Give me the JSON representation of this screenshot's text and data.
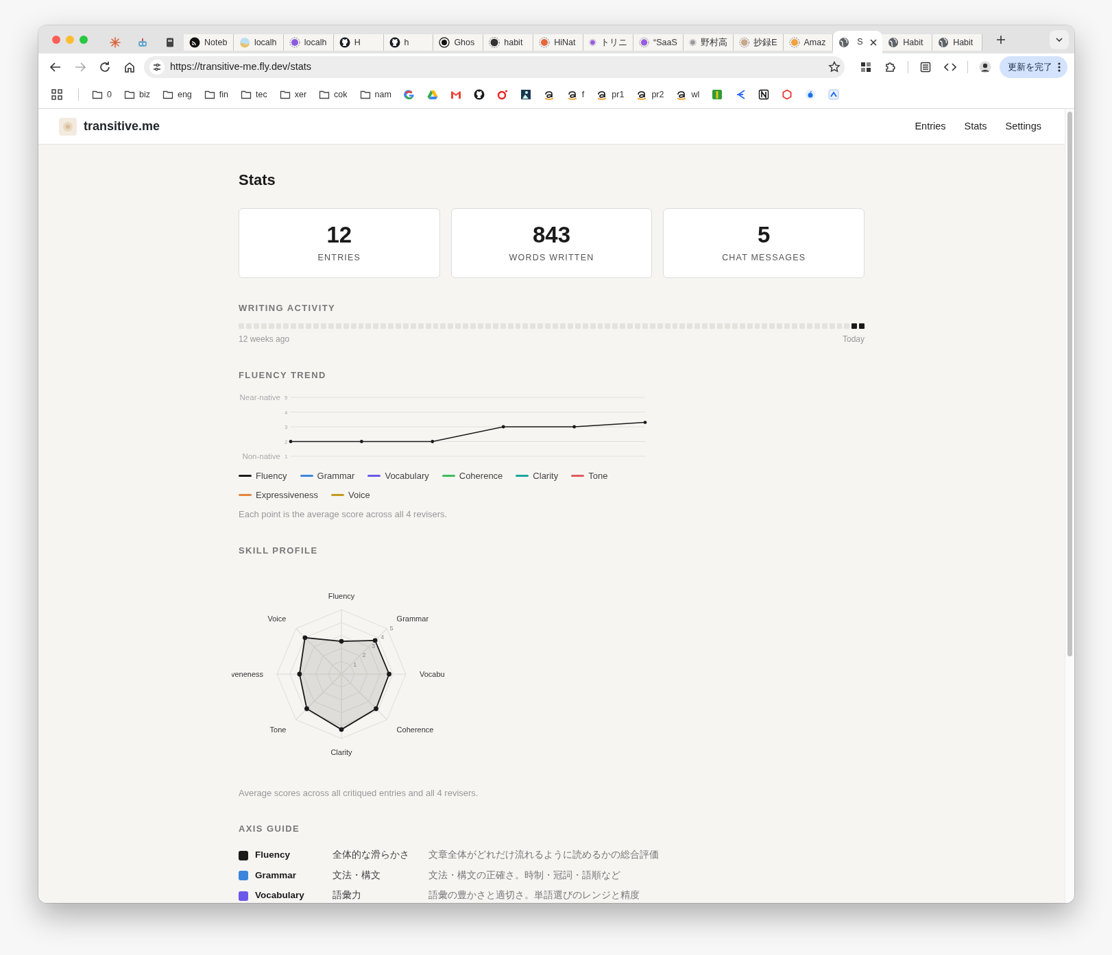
{
  "browser": {
    "tabs": [
      {
        "kind": "pinned",
        "selected": false
      },
      {
        "kind": "pinned",
        "selected": false
      },
      {
        "kind": "pinned",
        "selected": false
      },
      {
        "kind": "page",
        "title": "Noteb",
        "selected": false
      },
      {
        "kind": "page",
        "title": "localh",
        "selected": false
      },
      {
        "kind": "page",
        "title": "localh",
        "selected": false
      },
      {
        "kind": "page",
        "title": "H",
        "selected": false
      },
      {
        "kind": "page",
        "title": "h",
        "selected": false
      },
      {
        "kind": "page",
        "title": "Ghos",
        "selected": false
      },
      {
        "kind": "page",
        "title": "habit",
        "selected": false
      },
      {
        "kind": "page",
        "title": "HiNat",
        "selected": false
      },
      {
        "kind": "page",
        "title": "トリニ",
        "selected": false
      },
      {
        "kind": "page",
        "title": "“SaaS",
        "selected": false
      },
      {
        "kind": "page",
        "title": "野村高",
        "selected": false
      },
      {
        "kind": "page",
        "title": "抄録E",
        "selected": false
      },
      {
        "kind": "page",
        "title": "Amaz",
        "selected": false
      },
      {
        "kind": "page",
        "title": "S",
        "selected": true
      },
      {
        "kind": "page",
        "title": "Habit",
        "selected": false
      },
      {
        "kind": "page",
        "title": "Habit",
        "selected": false
      }
    ],
    "address": {
      "url": "https://transitive-me.fly.dev/stats"
    },
    "update_button": {
      "label": "更新を完了"
    },
    "bookmarks": [
      {
        "kind": "folder",
        "label": "0"
      },
      {
        "kind": "folder",
        "label": "biz"
      },
      {
        "kind": "folder",
        "label": "eng"
      },
      {
        "kind": "folder",
        "label": "fin"
      },
      {
        "kind": "folder",
        "label": "tec"
      },
      {
        "kind": "folder",
        "label": "xer"
      },
      {
        "kind": "folder",
        "label": "cok"
      },
      {
        "kind": "folder",
        "label": "nam"
      },
      {
        "kind": "site"
      },
      {
        "kind": "site"
      },
      {
        "kind": "site"
      },
      {
        "kind": "site"
      },
      {
        "kind": "site"
      },
      {
        "kind": "site"
      },
      {
        "kind": "site"
      },
      {
        "kind": "site",
        "label": "f"
      },
      {
        "kind": "site",
        "label": "pr1"
      },
      {
        "kind": "site",
        "label": "pr2"
      },
      {
        "kind": "site",
        "label": "wl"
      },
      {
        "kind": "site"
      },
      {
        "kind": "site"
      },
      {
        "kind": "site"
      },
      {
        "kind": "site"
      },
      {
        "kind": "site"
      },
      {
        "kind": "site"
      }
    ]
  },
  "app": {
    "brand": "transitive.me",
    "nav": [
      "Entries",
      "Stats",
      "Settings"
    ]
  },
  "page_title": "Stats",
  "stat_cards": [
    {
      "value": "12",
      "label": "ENTRIES"
    },
    {
      "value": "843",
      "label": "WORDS WRITTEN"
    },
    {
      "value": "5",
      "label": "CHAT MESSAGES"
    }
  ],
  "writing_activity": {
    "title": "WRITING ACTIVITY",
    "start_label": "12 weeks ago",
    "end_label": "Today",
    "days": [
      {
        "active": false
      },
      {
        "active": false
      },
      {
        "active": false
      },
      {
        "active": false
      },
      {
        "active": false
      },
      {
        "active": false
      },
      {
        "active": false
      },
      {
        "active": false
      },
      {
        "active": false
      },
      {
        "active": false
      },
      {
        "active": false
      },
      {
        "active": false
      },
      {
        "active": false
      },
      {
        "active": false
      },
      {
        "active": false
      },
      {
        "active": false
      },
      {
        "active": false
      },
      {
        "active": false
      },
      {
        "active": false
      },
      {
        "active": false
      },
      {
        "active": false
      },
      {
        "active": false
      },
      {
        "active": false
      },
      {
        "active": false
      },
      {
        "active": false
      },
      {
        "active": false
      },
      {
        "active": false
      },
      {
        "active": false
      },
      {
        "active": false
      },
      {
        "active": false
      },
      {
        "active": false
      },
      {
        "active": false
      },
      {
        "active": false
      },
      {
        "active": false
      },
      {
        "active": false
      },
      {
        "active": false
      },
      {
        "active": false
      },
      {
        "active": false
      },
      {
        "active": false
      },
      {
        "active": false
      },
      {
        "active": false
      },
      {
        "active": false
      },
      {
        "active": false
      },
      {
        "active": false
      },
      {
        "active": false
      },
      {
        "active": false
      },
      {
        "active": false
      },
      {
        "active": false
      },
      {
        "active": false
      },
      {
        "active": false
      },
      {
        "active": false
      },
      {
        "active": false
      },
      {
        "active": false
      },
      {
        "active": false
      },
      {
        "active": false
      },
      {
        "active": false
      },
      {
        "active": false
      },
      {
        "active": false
      },
      {
        "active": false
      },
      {
        "active": false
      },
      {
        "active": false
      },
      {
        "active": false
      },
      {
        "active": false
      },
      {
        "active": false
      },
      {
        "active": false
      },
      {
        "active": false
      },
      {
        "active": false
      },
      {
        "active": false
      },
      {
        "active": false
      },
      {
        "active": false
      },
      {
        "active": false
      },
      {
        "active": false
      },
      {
        "active": false
      },
      {
        "active": false
      },
      {
        "active": false
      },
      {
        "active": false
      },
      {
        "active": false
      },
      {
        "active": false
      },
      {
        "active": false
      },
      {
        "active": false
      },
      {
        "active": false
      },
      {
        "active": false
      },
      {
        "active": true
      },
      {
        "active": true
      }
    ]
  },
  "fluency_trend": {
    "title": "FLUENCY TREND",
    "y_top_label": "Near-native",
    "y_bottom_label": "Non-native",
    "chart_data": {
      "type": "line",
      "grid": true,
      "ylim": [
        1,
        5
      ],
      "yticks": [
        1,
        2,
        3,
        4,
        5
      ],
      "series": [
        {
          "name": "Fluency",
          "color": "#1a1a1a",
          "values": [
            2,
            2,
            2,
            3,
            3,
            3.3
          ]
        },
        {
          "name": "Grammar",
          "color": "#3b86dc",
          "values": [
            null,
            null,
            null,
            null,
            null,
            null
          ]
        },
        {
          "name": "Vocabulary",
          "color": "#6b57e8",
          "values": [
            null,
            null,
            null,
            null,
            null,
            null
          ]
        },
        {
          "name": "Coherence",
          "color": "#3dbb5c",
          "values": [
            null,
            null,
            null,
            null,
            null,
            null
          ]
        },
        {
          "name": "Clarity",
          "color": "#17a59d",
          "values": [
            null,
            null,
            null,
            null,
            null,
            null
          ]
        },
        {
          "name": "Tone",
          "color": "#e05c5c",
          "values": [
            null,
            null,
            null,
            null,
            null,
            null
          ]
        },
        {
          "name": "Expressiveness",
          "color": "#e5843c",
          "values": [
            null,
            null,
            null,
            null,
            null,
            null
          ]
        },
        {
          "name": "Voice",
          "color": "#c39a1c",
          "values": [
            null,
            null,
            null,
            null,
            null,
            null
          ]
        }
      ]
    },
    "caption": "Each point is the average score across all 4 revisers."
  },
  "skill_profile": {
    "title": "SKILL PROFILE",
    "ring_labels": [
      "1",
      "2",
      "3",
      "4",
      "5"
    ],
    "axes": [
      {
        "label": "Fluency",
        "level": 0.51
      },
      {
        "label": "Grammar",
        "level": 0.74
      },
      {
        "label": "Vocabu",
        "level": 0.74
      },
      {
        "label": "Coherence",
        "level": 0.76
      },
      {
        "label": "Clarity",
        "level": 0.86
      },
      {
        "label": "Tone",
        "level": 0.76
      },
      {
        "label": "veneness",
        "level": 0.65
      },
      {
        "label": "Voice",
        "level": 0.8
      }
    ],
    "caption": "Average scores across all critiqued entries and all 4 revisers."
  },
  "axis_guide": {
    "title": "AXIS GUIDE",
    "rows": [
      {
        "name": "Fluency",
        "color": "#1a1a1a",
        "short": "全体的な滑らかさ",
        "description": "文章全体がどれだけ流れるように読めるかの総合評価"
      },
      {
        "name": "Grammar",
        "color": "#3b86dc",
        "short": "文法・構文",
        "description": "文法・構文の正確さ。時制・冠詞・語順など"
      },
      {
        "name": "Vocabulary",
        "color": "#6b57e8",
        "short": "語彙力",
        "description": "語彙の豊かさと適切さ。単語選びのレンジと精度"
      }
    ]
  }
}
